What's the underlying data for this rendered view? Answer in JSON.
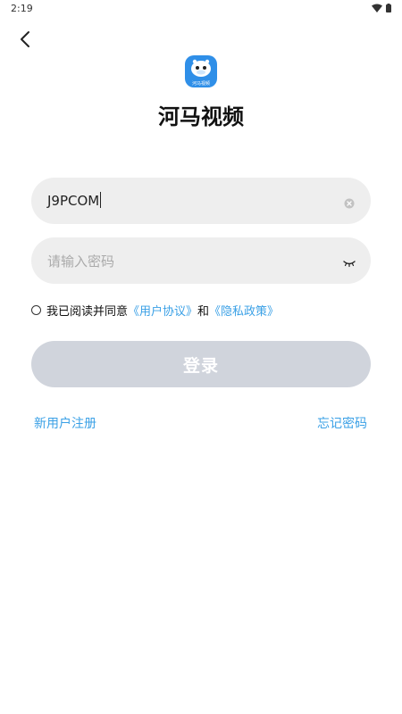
{
  "status_bar": {
    "time": "2:19",
    "icons": [
      "wifi-icon",
      "battery-icon"
    ]
  },
  "header": {
    "back_icon": "chevron-left-icon"
  },
  "app": {
    "logo_text": "河马视频",
    "name": "河马视频"
  },
  "form": {
    "username_value": "J9PCOM",
    "password_placeholder": "请输入密码",
    "clear_icon": "clear-icon",
    "eye_icon": "eye-closed-icon"
  },
  "agreement": {
    "prefix": "我已阅读并同意",
    "user_agreement": "《用户协议》",
    "conjunction": "和",
    "privacy_policy": "《隐私政策》",
    "checked": false
  },
  "login_button": "登录",
  "links": {
    "register": "新用户注册",
    "forgot_password": "忘记密码"
  },
  "colors": {
    "accent": "#3aa0e6",
    "button_disabled": "#d0d4dc",
    "field_bg": "#eeeeee"
  }
}
